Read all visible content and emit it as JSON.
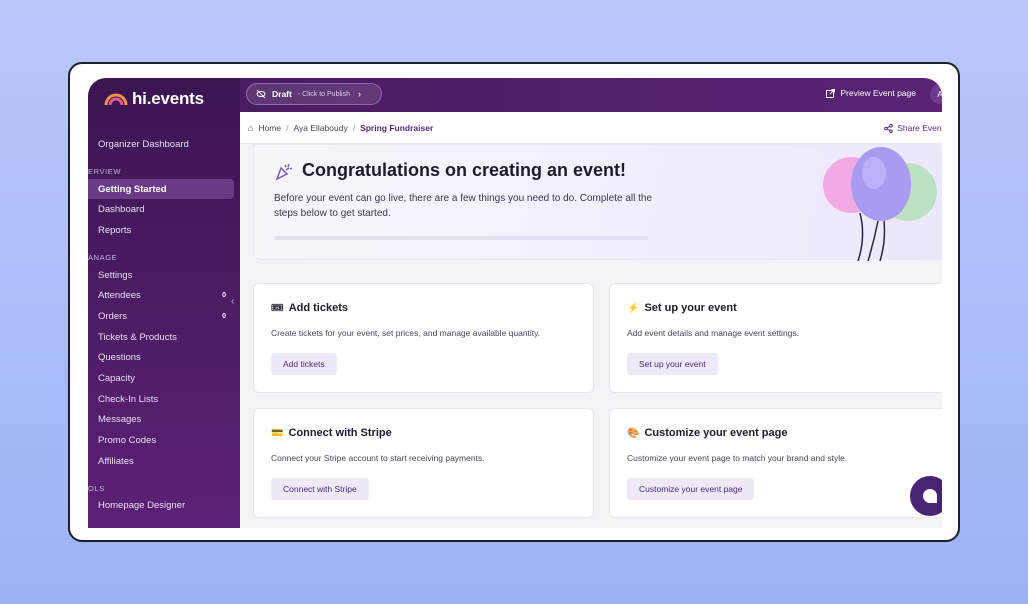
{
  "brand": {
    "logo_text": "hi.events"
  },
  "topbar": {
    "draft_label": "Draft",
    "draft_sub": "- Click to Publish",
    "preview_label": "Preview Event page",
    "avatar_initial": "A"
  },
  "breadcrumb": {
    "home": "Home",
    "org": "Aya Ellaboudy",
    "current": "Spring Fundraiser",
    "share": "Share Event"
  },
  "sidebar": {
    "organizer": "Organizer Dashboard",
    "section_overview": "ERVIEW",
    "overview_items": [
      {
        "label": "Getting Started"
      },
      {
        "label": "Dashboard"
      },
      {
        "label": "Reports"
      }
    ],
    "section_manage": "ANAGE",
    "manage_items": [
      {
        "label": "Settings"
      },
      {
        "label": "Attendees",
        "badge": "0"
      },
      {
        "label": "Orders",
        "badge": "0"
      },
      {
        "label": "Tickets & Products"
      },
      {
        "label": "Questions"
      },
      {
        "label": "Capacity"
      },
      {
        "label": "Check-In Lists"
      },
      {
        "label": "Messages"
      },
      {
        "label": "Promo Codes"
      },
      {
        "label": "Affiliates"
      }
    ],
    "section_tools": "OLS",
    "tools_items": [
      {
        "label": "Homepage Designer"
      }
    ]
  },
  "hero": {
    "title": "Congratulations on creating an event!",
    "description": "Before your event can go live, there are a few things you need to do. Complete all the steps below to get started.",
    "progress": 0.0
  },
  "cards": [
    {
      "icon": "ticket-icon",
      "title": "Add tickets",
      "description": "Create tickets for your event, set prices, and manage available quantity.",
      "button": "Add tickets"
    },
    {
      "icon": "lightning-icon",
      "title": "Set up your event",
      "description": "Add event details and manage event settings.",
      "button": "Set up your event"
    },
    {
      "icon": "credit-card-icon",
      "title": "Connect with Stripe",
      "description": "Connect your Stripe account to start receiving payments.",
      "button": "Connect with Stripe"
    },
    {
      "icon": "palette-icon",
      "title": "Customize your event page",
      "description": "Customize your event page to match your brand and style.",
      "button": "Customize your event page"
    }
  ],
  "colors": {
    "sidebar": "#4e1c66",
    "accent": "#5b2c86",
    "button_bg": "#efe9f7"
  }
}
